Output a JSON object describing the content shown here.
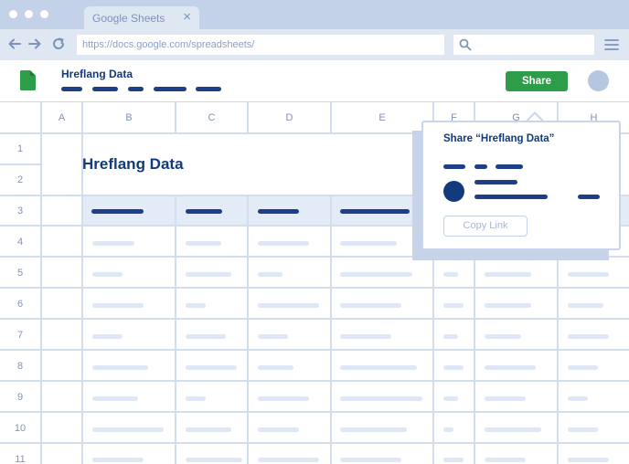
{
  "browser": {
    "tab_title": "Google Sheets",
    "tab_close": "×",
    "url": "https://docs.google.com/spreadsheets/"
  },
  "app": {
    "doc_title": "Hreflang Data",
    "share_label": "Share"
  },
  "sheet": {
    "columns": [
      "A",
      "B",
      "C",
      "D",
      "E",
      "F",
      "G",
      "H"
    ],
    "rows": [
      "1",
      "2",
      "3",
      "4",
      "5",
      "6",
      "7",
      "8",
      "9",
      "10",
      "11"
    ],
    "title": "Hreflang Data"
  },
  "share_dialog": {
    "title": "Share “Hreflang Data”",
    "copy_link_label": "Copy Link"
  },
  "colors": {
    "accent_blue": "#1d3f87",
    "share_green": "#2e9d4a",
    "chrome": "#c3d2e8"
  },
  "icons": [
    "back-arrow-icon",
    "forward-arrow-icon",
    "reload-icon",
    "search-icon",
    "menu-icon",
    "sheets-logo-icon"
  ]
}
